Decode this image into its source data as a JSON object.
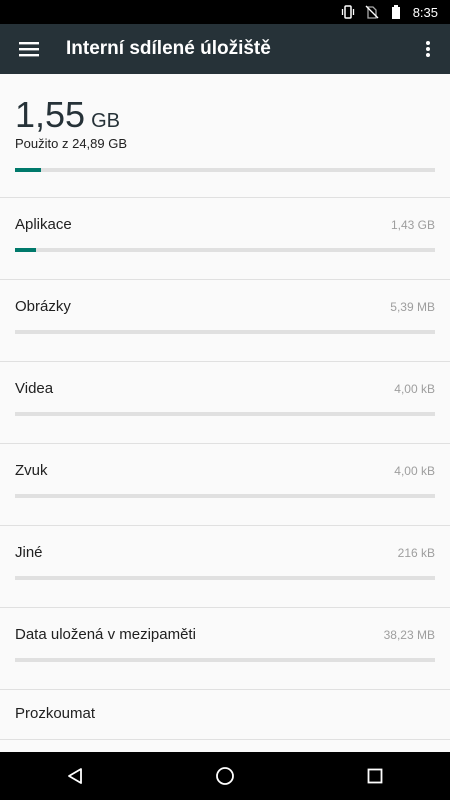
{
  "status_bar": {
    "time": "8:35",
    "icons": [
      "vibrate-icon",
      "no-sim-icon",
      "battery-icon"
    ]
  },
  "app_bar": {
    "title": "Interní sdílené úložiště",
    "menu_icon": "hamburger-menu-icon",
    "more_icon": "more-vert-icon"
  },
  "summary": {
    "used_value": "1,55",
    "used_unit": "GB",
    "subtitle": "Použito z 24,89 GB",
    "usage_fraction": 0.062
  },
  "categories": [
    {
      "label": "Aplikace",
      "size": "1,43 GB",
      "usage_fraction": 0.05
    },
    {
      "label": "Obrázky",
      "size": "5,39 MB",
      "usage_fraction": 0.0
    },
    {
      "label": "Videa",
      "size": "4,00 kB",
      "usage_fraction": 0.0
    },
    {
      "label": "Zvuk",
      "size": "4,00 kB",
      "usage_fraction": 0.0
    },
    {
      "label": "Jiné",
      "size": "216 kB",
      "usage_fraction": 0.0
    },
    {
      "label": "Data uložená v mezipaměti",
      "size": "38,23 MB",
      "usage_fraction": 0.0
    }
  ],
  "explore": {
    "label": "Prozkoumat"
  },
  "nav_bar": {
    "icons": [
      "back-icon",
      "home-icon",
      "recents-icon"
    ]
  },
  "colors": {
    "app_bar": "#263238",
    "accent": "#00796b",
    "track": "#e0e0e0"
  }
}
